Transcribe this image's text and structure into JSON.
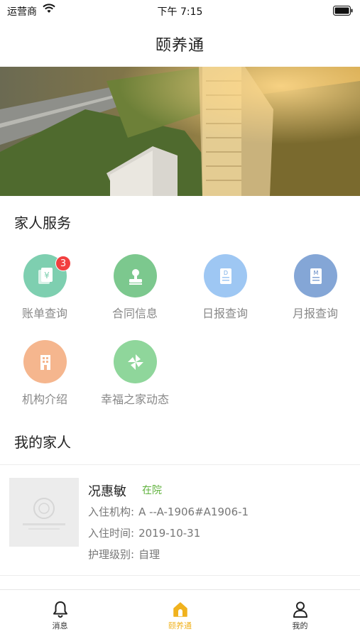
{
  "status_bar": {
    "carrier": "运营商",
    "time": "下午 7:15"
  },
  "navbar": {
    "title": "颐养通"
  },
  "services": {
    "section_title": "家人服务",
    "items": [
      {
        "label": "账单查询",
        "icon": "bill-icon",
        "color": "#7ecfb0",
        "badge": "3"
      },
      {
        "label": "合同信息",
        "icon": "contract-stamp-icon",
        "color": "#7cc88e"
      },
      {
        "label": "日报查询",
        "icon": "daily-report-icon",
        "color": "#9ec7f3"
      },
      {
        "label": "月报查询",
        "icon": "monthly-report-icon",
        "color": "#84a6d6"
      },
      {
        "label": "机构介绍",
        "icon": "building-icon",
        "color": "#f5b68e"
      },
      {
        "label": "幸福之家动态",
        "icon": "pinwheel-icon",
        "color": "#8fd69b"
      }
    ]
  },
  "family": {
    "section_title": "我的家人",
    "member": {
      "name": "况惠敏",
      "status": "在院",
      "institution_label": "入住机构:",
      "institution": "A --A-1906#A1906-1",
      "checkin_label": "入住时间:",
      "checkin": "2019-10-31",
      "care_label": "护理级别:",
      "care": "自理"
    }
  },
  "tabbar": {
    "tabs": [
      {
        "label": "消息",
        "icon": "bell-icon"
      },
      {
        "label": "颐养通",
        "icon": "home-icon",
        "active": true
      },
      {
        "label": "我的",
        "icon": "person-icon"
      }
    ],
    "active_color": "#f0b21e"
  }
}
